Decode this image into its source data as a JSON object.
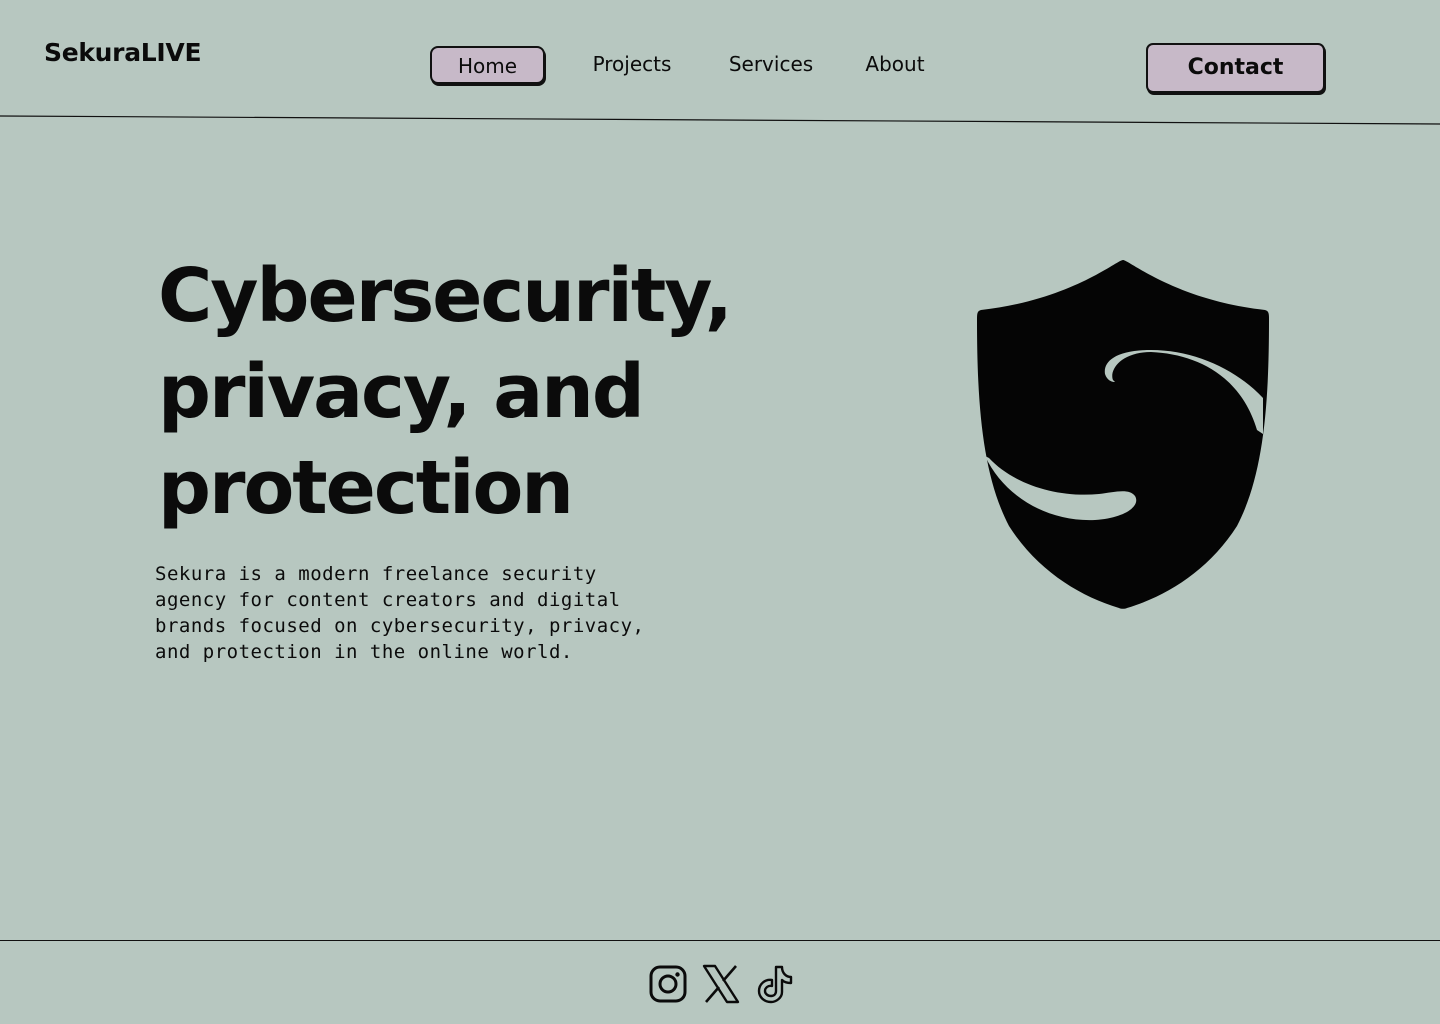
{
  "brand": {
    "name": "SekuraLIVE"
  },
  "nav": {
    "items": [
      {
        "label": "Home",
        "active": true
      },
      {
        "label": "Projects",
        "active": false
      },
      {
        "label": "Services",
        "active": false
      },
      {
        "label": "About",
        "active": false
      }
    ],
    "contact_label": "Contact"
  },
  "hero": {
    "title_lines": [
      "Cybersecurity,",
      "privacy, and",
      "protection"
    ],
    "description": "Sekura is a modern freelance security\nagency for content creators and digital\nbrands focused on cybersecurity, privacy,\nand protection in the online world."
  },
  "logo": {
    "icon": "shield-s-icon"
  },
  "footer": {
    "socials": [
      {
        "icon": "instagram-icon"
      },
      {
        "icon": "x-icon"
      },
      {
        "icon": "tiktok-icon"
      }
    ]
  },
  "colors": {
    "background": "#b7c7c0",
    "accent": "#c7b9c8",
    "text": "#0b0b0b"
  }
}
